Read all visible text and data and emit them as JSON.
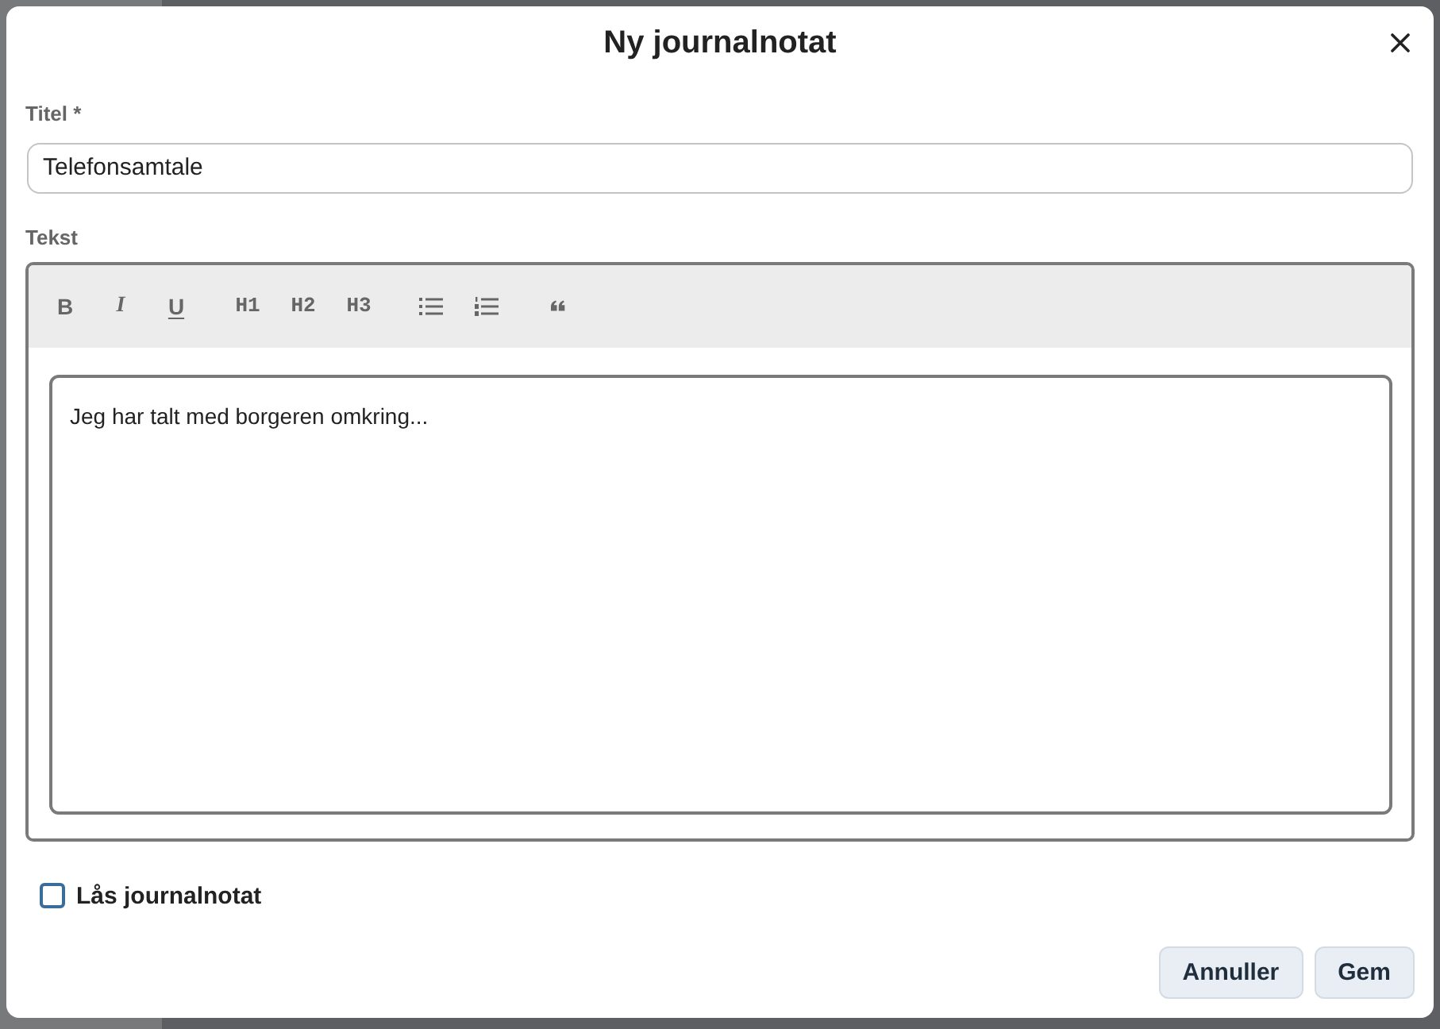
{
  "dialog": {
    "title": "Ny journalnotat"
  },
  "title_field": {
    "label": "Titel *",
    "value": "Telefonsamtale"
  },
  "text_field": {
    "label": "Tekst",
    "toolbar": [
      {
        "kind": "bold",
        "label": "B"
      },
      {
        "kind": "italic",
        "label": "I"
      },
      {
        "kind": "underline",
        "label": "U"
      },
      {
        "kind": "heading",
        "label": "H1"
      },
      {
        "kind": "heading",
        "label": "H2"
      },
      {
        "kind": "heading",
        "label": "H3"
      },
      {
        "kind": "bullet-list"
      },
      {
        "kind": "ordered-list"
      },
      {
        "kind": "quote"
      }
    ],
    "value": "Jeg har talt med borgeren omkring..."
  },
  "lock_checkbox": {
    "label": "Lås journalnotat",
    "checked": false
  },
  "buttons": [
    {
      "label": "Annuller"
    },
    {
      "label": "Gem"
    }
  ]
}
